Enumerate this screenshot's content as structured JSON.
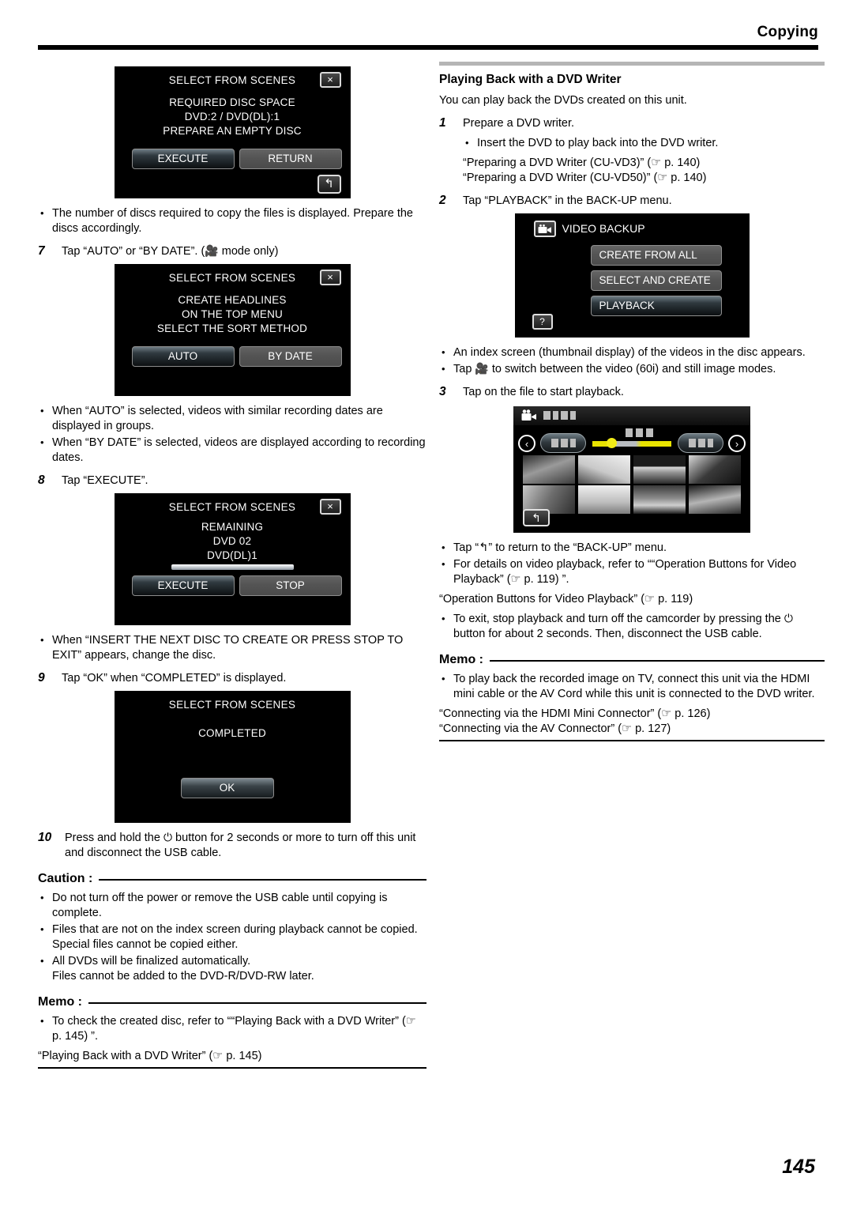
{
  "header": {
    "title": "Copying",
    "page_number": "145"
  },
  "left": {
    "dialog_required_space": {
      "title": "SELECT FROM SCENES",
      "close_icon": "×",
      "body_lines": [
        "REQUIRED DISC SPACE",
        "DVD:2 / DVD(DL):1",
        "PREPARE AN EMPTY DISC"
      ],
      "button_primary": "EXECUTE",
      "button_secondary": "RETURN",
      "return_icon": "↰"
    },
    "note_after_required": [
      "The number of discs required to copy the files is displayed. Prepare the discs accordingly."
    ],
    "step7": {
      "num": "7",
      "text_before": "Tap “AUTO” or “BY DATE”. (",
      "icon": "camcorder-icon",
      "text_after": " mode only)"
    },
    "dialog_sort_method": {
      "title": "SELECT FROM SCENES",
      "close_icon": "×",
      "body_lines": [
        "CREATE HEADLINES",
        "ON THE TOP MENU",
        "SELECT THE SORT METHOD"
      ],
      "button_primary": "AUTO",
      "button_secondary": "BY DATE"
    },
    "notes_sort": [
      "When “AUTO” is selected, videos with similar recording dates are displayed in groups.",
      "When “BY DATE” is selected, videos are displayed according to recording dates."
    ],
    "step8": {
      "num": "8",
      "text": "Tap “EXECUTE”."
    },
    "dialog_remaining": {
      "title": "SELECT FROM SCENES",
      "close_icon": "×",
      "body_lines": [
        "REMAINING",
        "DVD   02",
        "DVD(DL)1"
      ],
      "progress_percent": 100,
      "button_primary": "EXECUTE",
      "button_secondary": "STOP"
    },
    "notes_remaining": [
      "When “INSERT THE NEXT DISC TO CREATE OR PRESS STOP TO EXIT” appears, change the disc."
    ],
    "step9": {
      "num": "9",
      "text": "Tap “OK” when “COMPLETED” is displayed."
    },
    "dialog_completed": {
      "title": "SELECT FROM SCENES",
      "body_lines": [
        "COMPLETED"
      ],
      "button_ok": "OK"
    },
    "step10": {
      "num": "10",
      "text_before": "Press and hold the ",
      "icon": "power-icon",
      "text_after": " button for 2 seconds or more to turn off this unit and disconnect the USB cable."
    },
    "caution": {
      "label": "Caution :",
      "items": [
        "Do not turn off the power or remove the USB cable until copying is complete.",
        "Files that are not on the index screen during playback cannot be copied. Special files cannot be copied either.",
        "All DVDs will be finalized automatically.\nFiles cannot be added to the DVD-R/DVD-RW later."
      ]
    },
    "memo": {
      "label": "Memo :",
      "items": [
        "To check the created disc, refer to ““Playing Back with a DVD Writer” (☞ p. 145) ”."
      ],
      "reference": "“Playing Back with a DVD Writer” (☞ p. 145)"
    }
  },
  "right": {
    "section_title": "Playing Back with a DVD Writer",
    "intro": "You can play back the DVDs created on this unit.",
    "step1": {
      "num": "1",
      "text": "Prepare a DVD writer."
    },
    "step1_bullets": [
      "Insert the DVD to play back into the DVD writer."
    ],
    "step1_refs": [
      "“Preparing a DVD Writer (CU-VD3)” (☞ p. 140)",
      "“Preparing a DVD Writer (CU-VD50)” (☞ p. 140)"
    ],
    "step2": {
      "num": "2",
      "text": "Tap “PLAYBACK” in the BACK-UP menu."
    },
    "dialog_video_backup": {
      "title": "VIDEO BACKUP",
      "icon": "camcorder-icon",
      "buttons": [
        {
          "label": "CREATE FROM ALL",
          "selected": false
        },
        {
          "label": "SELECT AND CREATE",
          "selected": false
        },
        {
          "label": "PLAYBACK",
          "selected": true
        }
      ],
      "help_icon": "?"
    },
    "notes_after_backup_before": "Tap ",
    "notes_after_backup": [
      "An index screen (thumbnail display) of the videos in the disc appears."
    ],
    "note_switch_mode_after": " to switch between the video (60i) and still image modes.",
    "step3": {
      "num": "3",
      "text": "Tap on the file to start playback."
    },
    "index_screen": {
      "camcorder_icon": "camcorder-icon",
      "left_arrow_icon": "chevron-left-icon",
      "right_arrow_icon": "chevron-right-icon",
      "back_icon": "↰",
      "thumbnail_count": 8
    },
    "notes_playback": [
      "Tap “↰” to return to the “BACK-UP” menu.",
      "For details on video playback, refer to ““Operation Buttons for Video Playback” (☞ p. 119) ”."
    ],
    "ref_playback": "“Operation Buttons for Video Playback” (☞ p. 119)",
    "note_exit_before": "To exit, stop playback and turn off the camcorder by pressing the ",
    "note_exit_after": " button for about 2 seconds. Then, disconnect the USB cable.",
    "memo": {
      "label": "Memo :",
      "items": [
        "To play back the recorded image on TV, connect this unit via the HDMI mini cable or the AV Cord while this unit is connected to the DVD writer."
      ],
      "references": [
        "“Connecting via the HDMI Mini Connector” (☞ p. 126)",
        "“Connecting via the AV Connector” (☞ p. 127)"
      ]
    }
  }
}
